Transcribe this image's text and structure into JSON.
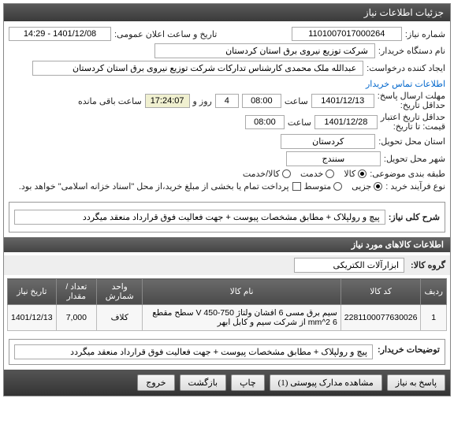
{
  "header": {
    "title": "جزئیات اطلاعات نیاز"
  },
  "fields": {
    "need_no_label": "شماره نیاز:",
    "need_no": "1101007017000264",
    "announce_label": "تاریخ و ساعت اعلان عمومی:",
    "announce_value": "1401/12/08 - 14:29",
    "buyer_org_label": "نام دستگاه خریدار:",
    "buyer_org": "شرکت توزیع نیروی برق استان کردستان",
    "requester_label": "ایجاد کننده درخواست:",
    "requester": "عبدالله ملک محمدی کارشناس تدارکات شرکت توزیع نیروی برق استان کردستان",
    "contact_link": "اطلاعات تماس خریدار",
    "deadline_send_label": "حداقل تاریخ:",
    "deadline_send_label2": "مهلت ارسال پاسخ:",
    "date1": "1401/12/13",
    "time_lbl": "ساعت",
    "time1": "08:00",
    "days_lbl": "روز و",
    "days": "4",
    "countdown": "17:24:07",
    "remain": "ساعت باقی مانده",
    "valid_price_label": "حداقل تاریخ اعتبار",
    "valid_price_label2": "قیمت: تا تاریخ:",
    "date2": "1401/12/28",
    "time2": "08:00",
    "province_label": "استان محل تحویل:",
    "province": "کردستان",
    "city_label": "شهر محل تحویل:",
    "city": "سنندج",
    "category_label": "طبقه بندی موضوعی:",
    "cat_goods": "کالا",
    "cat_service": "خدمت",
    "cat_both": "کالا/خدمت",
    "purchase_type_label": "نوع فرآیند خرید :",
    "pt_minor": "جزیی",
    "pt_medium": "متوسط",
    "pt_note": "پرداخت تمام یا بخشی از مبلغ خرید،از محل \"اسناد خزانه اسلامی\" خواهد بود."
  },
  "summary": {
    "title_label": "شرح کلی نیاز:",
    "title_text": "پیچ و رولپلاک  + مطابق مشخصات پیوست + جهت فعالیت فوق قرارداد منعقد میگردد"
  },
  "items_header": "اطلاعات کالاهای مورد نیاز",
  "group": {
    "label": "گروه کالا:",
    "value": "ابزارآلات الکتریکی"
  },
  "table": {
    "cols": {
      "row": "ردیف",
      "code": "کد کالا",
      "name": "نام کالا",
      "unit": "واحد شمارش",
      "qty": "تعداد / مقدار",
      "date": "تاریخ نیاز"
    },
    "rows": [
      {
        "idx": "1",
        "code": "2281100077630026",
        "name": "سیم برق مسی 6 افشان ولتاژ 750-450 V سطح مقطع 6 mm^2 از شرکت سیم و کابل ابهر",
        "unit": "کلاف",
        "qty": "7,000",
        "date": "1401/12/13"
      }
    ]
  },
  "buyer_note": {
    "label": "توضیحات خریدار:",
    "text": "پیچ و رولپلاک  + مطابق مشخصات پیوست + جهت فعالیت فوق قرارداد منعقد میگردد"
  },
  "footer": {
    "reply": "پاسخ به نیاز",
    "attach": "مشاهده مدارک پیوستی (1)",
    "print": "چاپ",
    "back": "بازگشت",
    "exit": "خروج"
  }
}
